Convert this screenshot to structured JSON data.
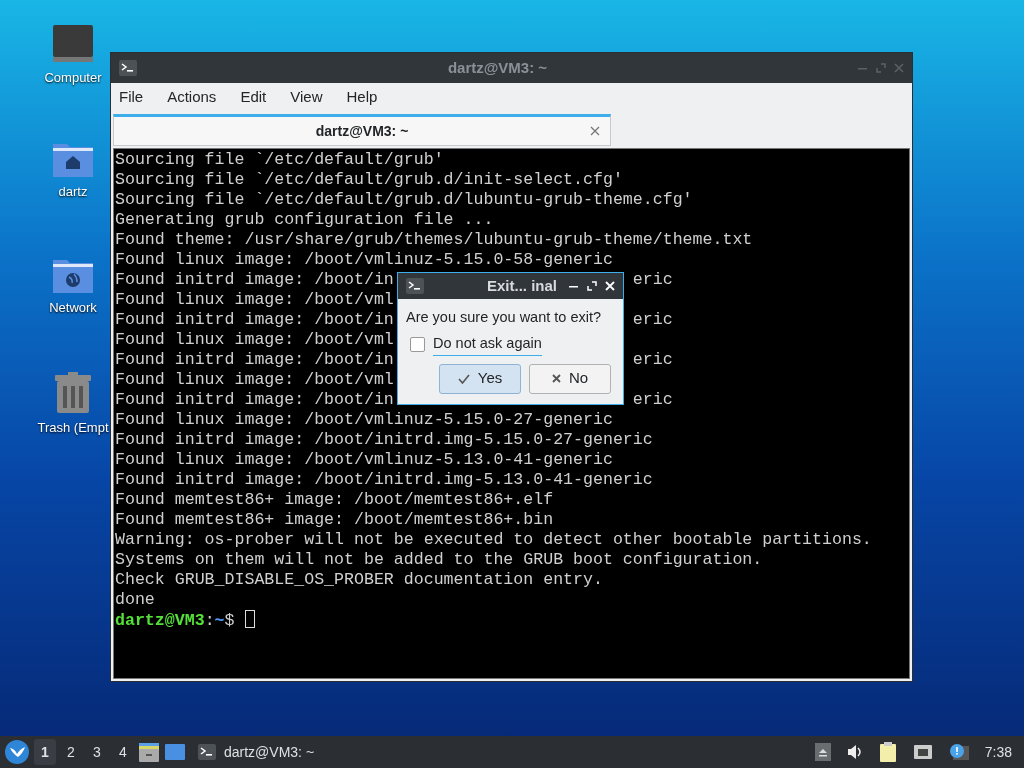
{
  "desktop_icons": [
    {
      "kind": "computer",
      "label": "Computer"
    },
    {
      "kind": "home",
      "label": "dartz"
    },
    {
      "kind": "network",
      "label": "Network"
    },
    {
      "kind": "trash",
      "label": "Trash (Empt"
    }
  ],
  "terminal_window": {
    "title": "dartz@VM3: ~",
    "menu": [
      "File",
      "Actions",
      "Edit",
      "View",
      "Help"
    ],
    "tabs": [
      {
        "label": "dartz@VM3: ~",
        "selected": true
      }
    ],
    "lines": [
      {
        "kind": "text",
        "text": "Sourcing file `/etc/default/grub'"
      },
      {
        "kind": "text",
        "text": "Sourcing file `/etc/default/grub.d/init-select.cfg'"
      },
      {
        "kind": "text",
        "text": "Sourcing file `/etc/default/grub.d/lubuntu-grub-theme.cfg'"
      },
      {
        "kind": "text",
        "text": "Generating grub configuration file ..."
      },
      {
        "kind": "text",
        "text": "Found theme: /usr/share/grub/themes/lubuntu-grub-theme/theme.txt"
      },
      {
        "kind": "text",
        "text": "Found linux image: /boot/vmlinuz-5.15.0-58-generic"
      },
      {
        "kind": "covered",
        "left": "Found initrd image: /boot/in",
        "right": "eric"
      },
      {
        "kind": "covered",
        "left": "Found linux image: /boot/vml"
      },
      {
        "kind": "covered",
        "left": "Found initrd image: /boot/in",
        "right": "eric"
      },
      {
        "kind": "covered",
        "left": "Found linux image: /boot/vml"
      },
      {
        "kind": "covered",
        "left": "Found initrd image: /boot/in",
        "right": "eric"
      },
      {
        "kind": "covered",
        "left": "Found linux image: /boot/vml"
      },
      {
        "kind": "covered",
        "left": "Found initrd image: /boot/in",
        "right": "eric"
      },
      {
        "kind": "text",
        "text": "Found linux image: /boot/vmlinuz-5.15.0-27-generic"
      },
      {
        "kind": "text",
        "text": "Found initrd image: /boot/initrd.img-5.15.0-27-generic"
      },
      {
        "kind": "text",
        "text": "Found linux image: /boot/vmlinuz-5.13.0-41-generic"
      },
      {
        "kind": "text",
        "text": "Found initrd image: /boot/initrd.img-5.13.0-41-generic"
      },
      {
        "kind": "text",
        "text": "Found memtest86+ image: /boot/memtest86+.elf"
      },
      {
        "kind": "text",
        "text": "Found memtest86+ image: /boot/memtest86+.bin"
      },
      {
        "kind": "text",
        "text": "Warning: os-prober will not be executed to detect other bootable partitions."
      },
      {
        "kind": "text",
        "text": "Systems on them will not be added to the GRUB boot configuration."
      },
      {
        "kind": "text",
        "text": "Check GRUB_DISABLE_OS_PROBER documentation entry."
      },
      {
        "kind": "text",
        "text": "done"
      },
      {
        "kind": "prompt",
        "user": "dartz@VM3",
        "sep": ":",
        "path": "~",
        "symbol": "$"
      }
    ]
  },
  "dialog": {
    "title": "Exit... inal",
    "message": "Are you sure you want to exit?",
    "checkbox": {
      "label": "Do not ask again",
      "checked": false
    },
    "buttons": [
      {
        "kind": "yes",
        "label": "Yes",
        "default": true
      },
      {
        "kind": "no",
        "label": "No",
        "default": false
      }
    ]
  },
  "taskbar": {
    "desktops": [
      {
        "label": "1",
        "selected": true
      },
      {
        "label": "2",
        "selected": false
      },
      {
        "label": "3",
        "selected": false
      },
      {
        "label": "4",
        "selected": false
      }
    ],
    "task": "dartz@VM3: ~",
    "clock": "7:38"
  }
}
